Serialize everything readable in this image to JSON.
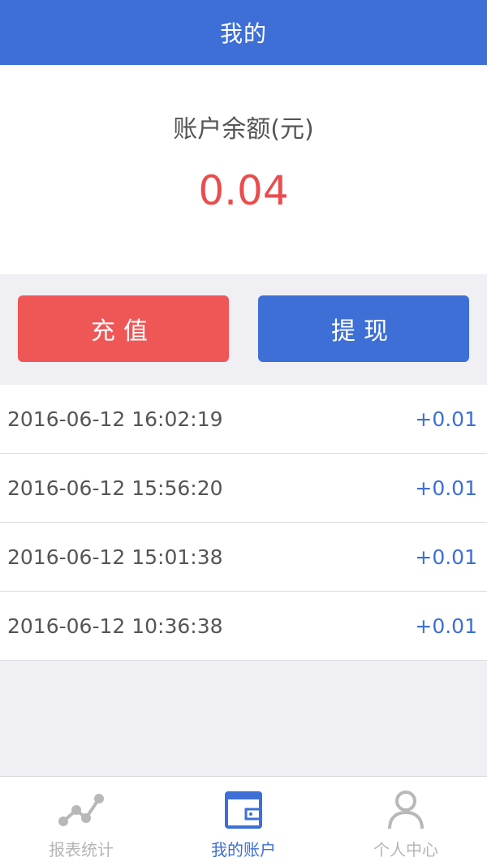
{
  "header": {
    "title": "我的"
  },
  "balance": {
    "label": "账户余额(元)",
    "value": "0.04"
  },
  "actions": {
    "recharge_label": "充值",
    "withdraw_label": "提现"
  },
  "records": [
    {
      "time": "2016-06-12 16:02:19",
      "amount": "+0.01"
    },
    {
      "time": "2016-06-12 15:56:20",
      "amount": "+0.01"
    },
    {
      "time": "2016-06-12 15:01:38",
      "amount": "+0.01"
    },
    {
      "time": "2016-06-12 10:36:38",
      "amount": "+0.01"
    }
  ],
  "tabbar": {
    "items": [
      {
        "label": "报表统计",
        "icon": "chart-line-icon",
        "active": false
      },
      {
        "label": "我的账户",
        "icon": "wallet-icon",
        "active": true
      },
      {
        "label": "个人中心",
        "icon": "user-icon",
        "active": false
      }
    ]
  },
  "colors": {
    "primary": "#3d6fd6",
    "danger": "#ef5656",
    "balance": "#ea4d4d",
    "inactive": "#b5b5b5"
  }
}
